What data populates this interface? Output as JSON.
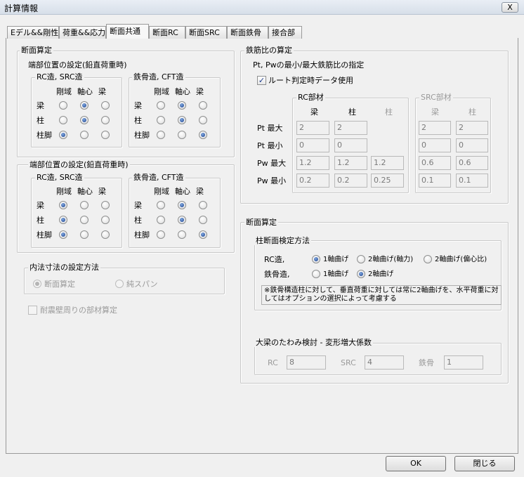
{
  "window": {
    "title": "計算情報",
    "close": "X"
  },
  "tabs": [
    {
      "label": "Eデル&&剛性"
    },
    {
      "label": "荷重&&応力"
    },
    {
      "label": "断面共通"
    },
    {
      "label": "断面RC"
    },
    {
      "label": "断面SRC"
    },
    {
      "label": "断面鉄骨"
    },
    {
      "label": "接合部"
    }
  ],
  "left": {
    "title": "断面算定",
    "beam_group": {
      "title": "端部位置の設定(鉛直荷重時)",
      "rc": {
        "title": "RC造, SRC造",
        "cols": [
          "剛域",
          "軸心",
          "梁"
        ],
        "rows": [
          "梁",
          "柱",
          "柱脚"
        ],
        "selected": [
          1,
          1,
          0
        ]
      },
      "steel": {
        "title": "鉄骨造, CFT造",
        "cols": [
          "剛域",
          "軸心",
          "梁"
        ],
        "rows": [
          "梁",
          "柱",
          "柱脚"
        ],
        "selected": [
          1,
          1,
          2
        ]
      }
    },
    "beam_group2": {
      "title": "端部位置の設定(鉛直荷重時)",
      "rc": {
        "title": "RC造, SRC造",
        "cols": [
          "剛域",
          "軸心",
          "梁"
        ],
        "rows": [
          "梁",
          "柱",
          "柱脚"
        ],
        "selected": [
          0,
          0,
          0
        ]
      },
      "steel": {
        "title": "鉄骨造, CFT造",
        "cols": [
          "剛域",
          "軸心",
          "梁"
        ],
        "rows": [
          "梁",
          "柱",
          "柱脚"
        ],
        "selected": [
          1,
          1,
          2
        ]
      }
    },
    "inner": {
      "title": "内法寸法の設定方法",
      "opt1": "断面算定",
      "opt2": "純スパン",
      "selected": 0
    },
    "seismic_wall": {
      "label": "耐震壁周りの部材算定",
      "checked": false
    }
  },
  "rebar": {
    "title": "鉄筋比の算定",
    "sub": "Pt, Pwの最小/最大鉄筋比の指定",
    "route_check": {
      "label": "ルート判定時データ使用",
      "checked": true
    },
    "rc_title": "RC部材",
    "src_title": "SRC部材",
    "rc_cols": [
      "梁",
      "柱",
      "柱"
    ],
    "src_cols": [
      "梁",
      "柱"
    ],
    "rows": [
      {
        "label": "Pt 最大",
        "rc": [
          "2",
          "2",
          ""
        ],
        "src": [
          "2",
          "2"
        ]
      },
      {
        "label": "Pt 最小",
        "rc": [
          "0",
          "0",
          ""
        ],
        "src": [
          "0",
          "0"
        ]
      },
      {
        "label": "Pw 最大",
        "rc": [
          "1.2",
          "1.2",
          "1.2"
        ],
        "src": [
          "0.6",
          "0.6"
        ]
      },
      {
        "label": "Pw 最小",
        "rc": [
          "0.2",
          "0.2",
          "0.25"
        ],
        "src": [
          "0.1",
          "0.1"
        ]
      }
    ]
  },
  "section": {
    "title": "断面算定",
    "column": {
      "title": "柱断面検定方法",
      "rc_label": "RC造,",
      "rc_opts": [
        "1軸曲げ",
        "2軸曲げ(軸力)",
        "2軸曲げ(偏心比)"
      ],
      "rc_selected": 0,
      "steel_label": "鉄骨造,",
      "steel_opts": [
        "1軸曲げ",
        "2軸曲げ"
      ],
      "steel_selected": 1,
      "note": "※鉄骨構造柱に対して、垂直荷重に対しては常に2軸曲げを、水平荷重に対してはオプションの選択によって考慮する"
    },
    "deflection": {
      "title": "大梁のたわみ検討 - 変形増大係数",
      "rc_label": "RC",
      "rc_value": "8",
      "src_label": "SRC",
      "src_value": "4",
      "steel_label": "鉄骨",
      "steel_value": "1"
    }
  },
  "buttons": {
    "ok": "OK",
    "close": "閉じる"
  }
}
